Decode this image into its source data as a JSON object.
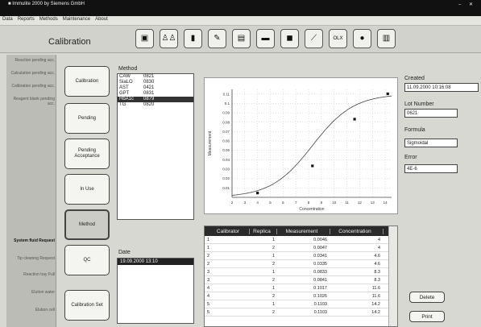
{
  "window": {
    "title": "■ Immulite 2000 by Siemens GmbH",
    "controls": "– ✕"
  },
  "menu": [
    "Data",
    "Reports",
    "Methods",
    "Maintenance",
    "About"
  ],
  "screen_title": "Calibration",
  "toolbar": [
    {
      "name": "analyzer",
      "glyph": "▣"
    },
    {
      "name": "users",
      "glyph": "♙♙"
    },
    {
      "name": "reagent",
      "glyph": "▮"
    },
    {
      "name": "edit",
      "glyph": "✎"
    },
    {
      "name": "book",
      "glyph": "▤"
    },
    {
      "name": "reader",
      "glyph": "▬"
    },
    {
      "name": "tape",
      "glyph": "◼"
    },
    {
      "name": "graph",
      "glyph": "⟋"
    },
    {
      "name": "olx",
      "glyph": "OLX"
    },
    {
      "name": "qc",
      "glyph": "●"
    },
    {
      "name": "clipboard",
      "glyph": "▥"
    }
  ],
  "left_nav": {
    "top": [
      "Reaction pending acc.",
      "Calculation pending acc.",
      "Calibration pending acc.",
      "Reagent blank pending acc."
    ],
    "system_label": "System fluid Request",
    "bottom": [
      "Tip cleaning Request",
      "Reaction tray Full",
      "Elution water",
      "Elution cell"
    ]
  },
  "side_buttons": [
    "Calibration",
    "Pending",
    "Pending Acceptance",
    "In Use",
    "Method",
    "QC",
    "Calibration Set"
  ],
  "method_label": "Method",
  "methods": [
    {
      "name": "CAW",
      "code": "0821"
    },
    {
      "name": "SiaLO",
      "code": "0830"
    },
    {
      "name": "AST",
      "code": "0421"
    },
    {
      "name": "GPT",
      "code": "0831"
    },
    {
      "name": "HbA1c",
      "code": "0879"
    },
    {
      "name": "TG",
      "code": "0820"
    }
  ],
  "date_label": "Date",
  "dates": [
    "19.09.2000 13:10"
  ],
  "right": {
    "created_label": "Created",
    "created_value": "11.09.2000 10:16:08",
    "lot_label": "Lot Number",
    "lot_value": "0621",
    "formula_label": "Formula",
    "formula_value": "Sigmoidal",
    "error_label": "Error",
    "error_value": "4E-6",
    "delete_label": "Delete",
    "print_label": "Print"
  },
  "table": {
    "headers": [
      "Calibrator",
      "Replica",
      "Measurement",
      "Concentration"
    ],
    "rows": [
      [
        "1",
        "1",
        "0.0046",
        "4"
      ],
      [
        "1",
        "2",
        "0.0047",
        "4"
      ],
      [
        "2",
        "1",
        "0.0341",
        "4.6"
      ],
      [
        "2",
        "2",
        "0.0335",
        "4.6"
      ],
      [
        "3",
        "1",
        "0.0833",
        "8.3"
      ],
      [
        "3",
        "2",
        "0.0841",
        "8.3"
      ],
      [
        "4",
        "1",
        "0.1017",
        "11.6"
      ],
      [
        "4",
        "2",
        "0.1026",
        "11.6"
      ],
      [
        "5",
        "1",
        "0.1103",
        "14.2"
      ],
      [
        "5",
        "2",
        "0.1103",
        "14.2"
      ]
    ]
  },
  "chart_data": {
    "type": "scatter",
    "xlabel": "Concentration",
    "ylabel": "Measurement",
    "x_ticks": [
      "2",
      "3",
      "4",
      "5",
      "6",
      "7",
      "8",
      "9",
      "10",
      "11",
      "12",
      "13",
      "14"
    ],
    "y_ticks": [
      "0.11",
      "0.1",
      "0.09",
      "0.08",
      "0.07",
      "0.06",
      "0.05",
      "0.04",
      "0.03",
      "0.02",
      "0.01"
    ],
    "xlim": [
      2,
      14.5
    ],
    "ylim": [
      0,
      0.115
    ],
    "series": [
      {
        "values_x": [
          4,
          8.3,
          11.6,
          14.2
        ],
        "values_y": [
          0.0046,
          0.0335,
          0.0833,
          0.1103
        ]
      }
    ],
    "curve": "sigmoidal"
  }
}
